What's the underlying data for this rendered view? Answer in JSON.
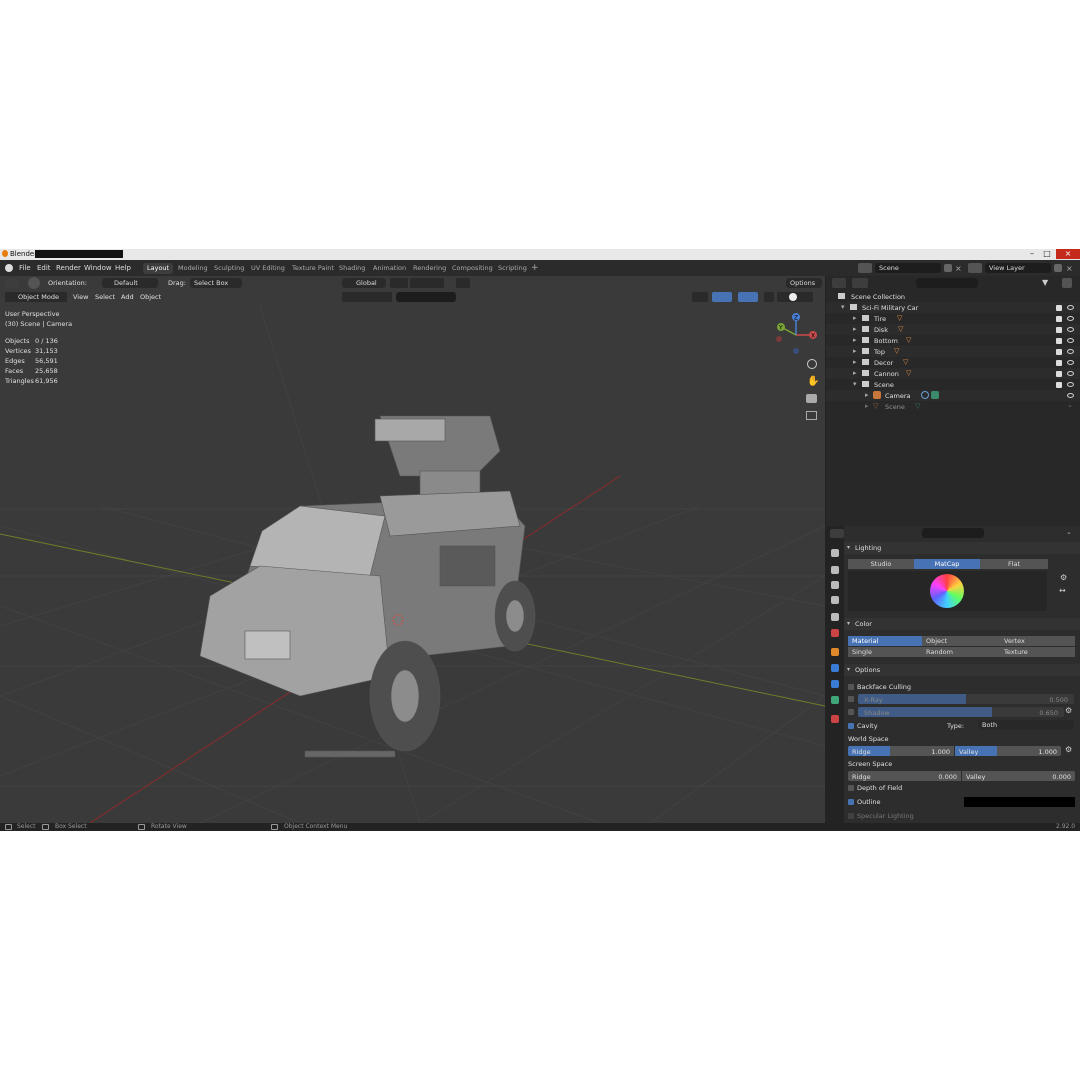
{
  "titlebar": {
    "title": "Blender"
  },
  "menu": [
    "File",
    "Edit",
    "Render",
    "Window",
    "Help"
  ],
  "workspaces": [
    "Layout",
    "Modeling",
    "Sculpting",
    "UV Editing",
    "Texture Paint",
    "Shading",
    "Animation",
    "Rendering",
    "Compositing",
    "Scripting"
  ],
  "active_workspace": "Layout",
  "scene": {
    "name": "Scene",
    "view_layer": "View Layer"
  },
  "tool_header": {
    "orientation_label": "Orientation:",
    "orientation_value": "Default",
    "drag_label": "Drag:",
    "drag_value": "Select Box",
    "transform_orientation": "Global",
    "options": "Options"
  },
  "viewport_header": {
    "mode": "Object Mode",
    "items": [
      "View",
      "Select",
      "Add",
      "Object"
    ]
  },
  "viewport_info": {
    "perspective": "User Perspective",
    "context": "(30) Scene | Camera",
    "stats": [
      {
        "label": "Objects",
        "value": "0 / 136"
      },
      {
        "label": "Vertices",
        "value": "31,153"
      },
      {
        "label": "Edges",
        "value": "56,591"
      },
      {
        "label": "Faces",
        "value": "25,658"
      },
      {
        "label": "Triangles",
        "value": "61,956"
      }
    ]
  },
  "gizmo": {
    "x": "X",
    "y": "Y",
    "z": "Z"
  },
  "outliner": {
    "root": "Scene Collection",
    "items": [
      {
        "name": "Sci-Fi Military Car",
        "indent": 1
      },
      {
        "name": "Tire",
        "indent": 2
      },
      {
        "name": "Disk",
        "indent": 2
      },
      {
        "name": "Bottom",
        "indent": 2
      },
      {
        "name": "Top",
        "indent": 2
      },
      {
        "name": "Decor",
        "indent": 2
      },
      {
        "name": "Cannon",
        "indent": 2
      },
      {
        "name": "Scene",
        "indent": 2
      },
      {
        "name": "Camera",
        "indent": 3
      },
      {
        "name": "Scene",
        "indent": 3
      }
    ]
  },
  "properties": {
    "lighting_header": "Lighting",
    "lighting_modes": [
      "Studio",
      "MatCap",
      "Flat"
    ],
    "lighting_active": "MatCap",
    "color_header": "Color",
    "color_modes": [
      "Material",
      "Object",
      "Vertex",
      "Single",
      "Random",
      "Texture"
    ],
    "color_active": "Material",
    "options_header": "Options",
    "backface": "Backface Culling",
    "xray": {
      "label": "X-Ray",
      "value": "0.500",
      "fill": 0.5
    },
    "shadow": {
      "label": "Shadow",
      "value": "0.650",
      "fill": 0.65
    },
    "cavity": "Cavity",
    "type_label": "Type:",
    "type_value": "Both",
    "world_space": "World Space",
    "ws_ridge": {
      "label": "Ridge",
      "value": "1.000"
    },
    "ws_valley": {
      "label": "Valley",
      "value": "1.000"
    },
    "screen_space": "Screen Space",
    "ss_ridge": {
      "label": "Ridge",
      "value": "0.000"
    },
    "ss_valley": {
      "label": "Valley",
      "value": "0.000"
    },
    "dof": "Depth of Field",
    "outline": "Outline",
    "specular": "Specular Lighting"
  },
  "statusbar": {
    "select": "Select",
    "box_select": "Box Select",
    "rotate": "Rotate View",
    "context_menu": "Object Context Menu",
    "version": "2.92.0"
  },
  "colors": {
    "accent": "#4772b3",
    "bg": "#3a3a3a",
    "panel": "#2d2d2d"
  }
}
